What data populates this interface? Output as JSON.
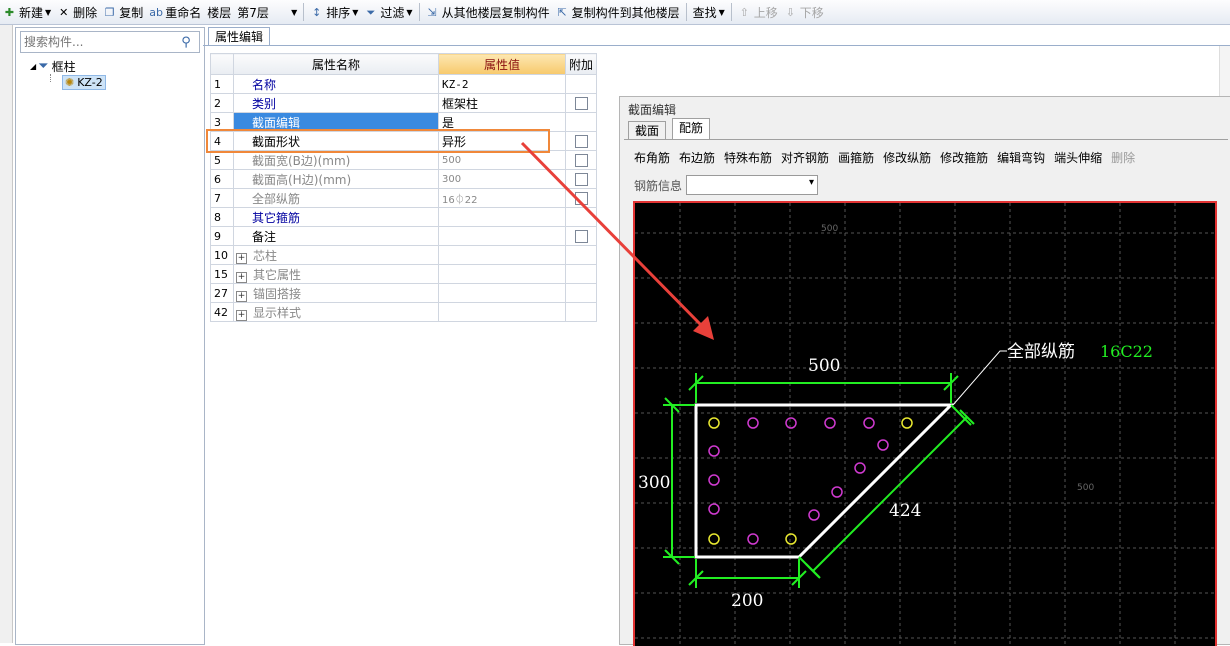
{
  "toolbar": {
    "new": "新建",
    "delete": "删除",
    "copy": "复制",
    "rename": "重命名",
    "floor_label": "楼层",
    "floor_value": "第7层",
    "sort": "排序",
    "filter": "过滤",
    "copy_from": "从其他楼层复制构件",
    "copy_to": "复制构件到其他楼层",
    "find": "查找",
    "move_up": "上移",
    "move_down": "下移"
  },
  "left_panel": {
    "search_placeholder": "搜索构件...",
    "tree_root": "框柱",
    "tree_child": "KZ-2"
  },
  "tab": {
    "label": "属性编辑"
  },
  "grid": {
    "headers": {
      "num": "",
      "name": "属性名称",
      "value": "属性值",
      "add": "附加"
    },
    "rows": [
      {
        "num": "1",
        "name": "名称",
        "value": "KZ-2"
      },
      {
        "num": "2",
        "name": "类别",
        "value": "框架柱"
      },
      {
        "num": "3",
        "name": "截面编辑",
        "value": "是"
      },
      {
        "num": "4",
        "name": "截面形状",
        "value": "异形"
      },
      {
        "num": "5",
        "name": "截面宽(B边)(mm)",
        "value": "500"
      },
      {
        "num": "6",
        "name": "截面高(H边)(mm)",
        "value": "300"
      },
      {
        "num": "7",
        "name": "全部纵筋",
        "value": "16⏀22"
      },
      {
        "num": "8",
        "name": "其它箍筋",
        "value": ""
      },
      {
        "num": "9",
        "name": "备注",
        "value": ""
      },
      {
        "num": "10",
        "name": "芯柱",
        "value": ""
      },
      {
        "num": "15",
        "name": "其它属性",
        "value": ""
      },
      {
        "num": "27",
        "name": "锚固搭接",
        "value": ""
      },
      {
        "num": "42",
        "name": "显示样式",
        "value": ""
      }
    ]
  },
  "dialog": {
    "title": "截面编辑",
    "tabs": [
      "截面",
      "配筋"
    ],
    "toolbar": [
      "布角筋",
      "布边筋",
      "特殊布筋",
      "对齐钢筋",
      "画箍筋",
      "修改纵筋",
      "修改箍筋",
      "编辑弯钩",
      "端头伸缩",
      "删除"
    ],
    "rebar_info_label": "钢筋信息",
    "canvas": {
      "dim_top": "500",
      "dim_left": "300",
      "dim_bottom": "200",
      "dim_diag": "424",
      "label_main": "全部纵筋",
      "label_value": "16C22",
      "grid_label_top": "500",
      "grid_label_right": "500"
    }
  },
  "colors": {
    "toolbar_bg": "#e6ebf3",
    "selected_row": "#3a8ae0",
    "header_value": "#f7c96c",
    "highlight_box": "#f0883a",
    "arrow": "#e8403a",
    "canvas_bg": "#000000",
    "dimension_green": "#22ee22",
    "rebar_magenta": "#d03ad0",
    "rebar_yellow": "#e8e830",
    "canvas_border": "#e23333"
  }
}
